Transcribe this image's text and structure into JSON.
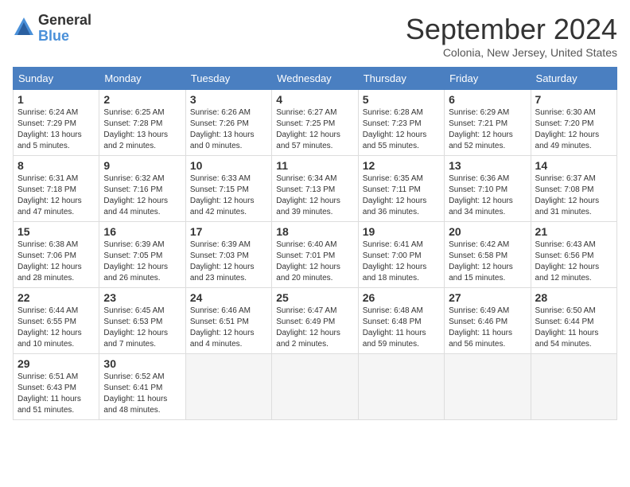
{
  "logo": {
    "general": "General",
    "blue": "Blue"
  },
  "header": {
    "month": "September 2024",
    "location": "Colonia, New Jersey, United States"
  },
  "weekdays": [
    "Sunday",
    "Monday",
    "Tuesday",
    "Wednesday",
    "Thursday",
    "Friday",
    "Saturday"
  ],
  "weeks": [
    [
      {
        "day": "1",
        "info": "Sunrise: 6:24 AM\nSunset: 7:29 PM\nDaylight: 13 hours\nand 5 minutes."
      },
      {
        "day": "2",
        "info": "Sunrise: 6:25 AM\nSunset: 7:28 PM\nDaylight: 13 hours\nand 2 minutes."
      },
      {
        "day": "3",
        "info": "Sunrise: 6:26 AM\nSunset: 7:26 PM\nDaylight: 13 hours\nand 0 minutes."
      },
      {
        "day": "4",
        "info": "Sunrise: 6:27 AM\nSunset: 7:25 PM\nDaylight: 12 hours\nand 57 minutes."
      },
      {
        "day": "5",
        "info": "Sunrise: 6:28 AM\nSunset: 7:23 PM\nDaylight: 12 hours\nand 55 minutes."
      },
      {
        "day": "6",
        "info": "Sunrise: 6:29 AM\nSunset: 7:21 PM\nDaylight: 12 hours\nand 52 minutes."
      },
      {
        "day": "7",
        "info": "Sunrise: 6:30 AM\nSunset: 7:20 PM\nDaylight: 12 hours\nand 49 minutes."
      }
    ],
    [
      {
        "day": "8",
        "info": "Sunrise: 6:31 AM\nSunset: 7:18 PM\nDaylight: 12 hours\nand 47 minutes."
      },
      {
        "day": "9",
        "info": "Sunrise: 6:32 AM\nSunset: 7:16 PM\nDaylight: 12 hours\nand 44 minutes."
      },
      {
        "day": "10",
        "info": "Sunrise: 6:33 AM\nSunset: 7:15 PM\nDaylight: 12 hours\nand 42 minutes."
      },
      {
        "day": "11",
        "info": "Sunrise: 6:34 AM\nSunset: 7:13 PM\nDaylight: 12 hours\nand 39 minutes."
      },
      {
        "day": "12",
        "info": "Sunrise: 6:35 AM\nSunset: 7:11 PM\nDaylight: 12 hours\nand 36 minutes."
      },
      {
        "day": "13",
        "info": "Sunrise: 6:36 AM\nSunset: 7:10 PM\nDaylight: 12 hours\nand 34 minutes."
      },
      {
        "day": "14",
        "info": "Sunrise: 6:37 AM\nSunset: 7:08 PM\nDaylight: 12 hours\nand 31 minutes."
      }
    ],
    [
      {
        "day": "15",
        "info": "Sunrise: 6:38 AM\nSunset: 7:06 PM\nDaylight: 12 hours\nand 28 minutes."
      },
      {
        "day": "16",
        "info": "Sunrise: 6:39 AM\nSunset: 7:05 PM\nDaylight: 12 hours\nand 26 minutes."
      },
      {
        "day": "17",
        "info": "Sunrise: 6:39 AM\nSunset: 7:03 PM\nDaylight: 12 hours\nand 23 minutes."
      },
      {
        "day": "18",
        "info": "Sunrise: 6:40 AM\nSunset: 7:01 PM\nDaylight: 12 hours\nand 20 minutes."
      },
      {
        "day": "19",
        "info": "Sunrise: 6:41 AM\nSunset: 7:00 PM\nDaylight: 12 hours\nand 18 minutes."
      },
      {
        "day": "20",
        "info": "Sunrise: 6:42 AM\nSunset: 6:58 PM\nDaylight: 12 hours\nand 15 minutes."
      },
      {
        "day": "21",
        "info": "Sunrise: 6:43 AM\nSunset: 6:56 PM\nDaylight: 12 hours\nand 12 minutes."
      }
    ],
    [
      {
        "day": "22",
        "info": "Sunrise: 6:44 AM\nSunset: 6:55 PM\nDaylight: 12 hours\nand 10 minutes."
      },
      {
        "day": "23",
        "info": "Sunrise: 6:45 AM\nSunset: 6:53 PM\nDaylight: 12 hours\nand 7 minutes."
      },
      {
        "day": "24",
        "info": "Sunrise: 6:46 AM\nSunset: 6:51 PM\nDaylight: 12 hours\nand 4 minutes."
      },
      {
        "day": "25",
        "info": "Sunrise: 6:47 AM\nSunset: 6:49 PM\nDaylight: 12 hours\nand 2 minutes."
      },
      {
        "day": "26",
        "info": "Sunrise: 6:48 AM\nSunset: 6:48 PM\nDaylight: 11 hours\nand 59 minutes."
      },
      {
        "day": "27",
        "info": "Sunrise: 6:49 AM\nSunset: 6:46 PM\nDaylight: 11 hours\nand 56 minutes."
      },
      {
        "day": "28",
        "info": "Sunrise: 6:50 AM\nSunset: 6:44 PM\nDaylight: 11 hours\nand 54 minutes."
      }
    ],
    [
      {
        "day": "29",
        "info": "Sunrise: 6:51 AM\nSunset: 6:43 PM\nDaylight: 11 hours\nand 51 minutes."
      },
      {
        "day": "30",
        "info": "Sunrise: 6:52 AM\nSunset: 6:41 PM\nDaylight: 11 hours\nand 48 minutes."
      },
      {
        "day": "",
        "info": ""
      },
      {
        "day": "",
        "info": ""
      },
      {
        "day": "",
        "info": ""
      },
      {
        "day": "",
        "info": ""
      },
      {
        "day": "",
        "info": ""
      }
    ]
  ]
}
